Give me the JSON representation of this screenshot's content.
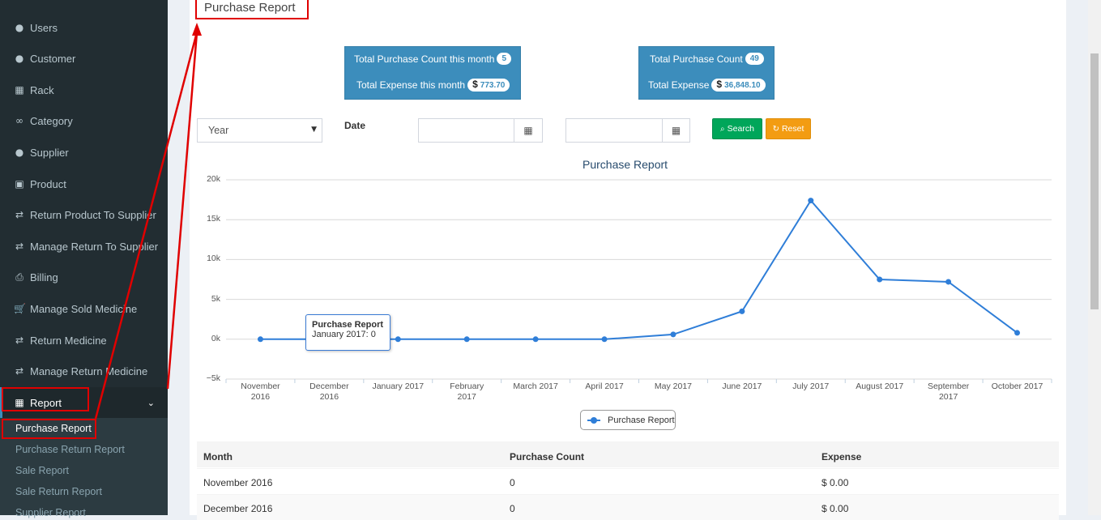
{
  "sidebar": {
    "items": [
      {
        "label": "Users",
        "icon": "user-icon",
        "glyph": "●"
      },
      {
        "label": "Customer",
        "icon": "user-icon",
        "glyph": "●"
      },
      {
        "label": "Rack",
        "icon": "table-icon",
        "glyph": "▦"
      },
      {
        "label": "Category",
        "icon": "link-icon",
        "glyph": "∞"
      },
      {
        "label": "Supplier",
        "icon": "user-icon",
        "glyph": "●"
      },
      {
        "label": "Product",
        "icon": "product-icon",
        "glyph": "▣"
      },
      {
        "label": "Return Product To Supplier",
        "icon": "exchange-icon",
        "glyph": "⇄"
      },
      {
        "label": "Manage Return To Supplier",
        "icon": "exchange-icon",
        "glyph": "⇄"
      },
      {
        "label": "Billing",
        "icon": "print-icon",
        "glyph": "⎙"
      },
      {
        "label": "Manage Sold Medicine",
        "icon": "cart-icon",
        "glyph": "🛒"
      },
      {
        "label": "Return Medicine",
        "icon": "exchange-icon",
        "glyph": "⇄"
      },
      {
        "label": "Manage Return Medicine",
        "icon": "exchange-icon",
        "glyph": "⇄"
      },
      {
        "label": "Report",
        "icon": "table-icon",
        "glyph": "▦"
      }
    ],
    "submenu": [
      "Purchase Report",
      "Purchase Return Report",
      "Sale Report",
      "Sale Return Report",
      "Supplier Report"
    ],
    "chevron": "⌄"
  },
  "page_title": "Purchase Report",
  "stats": {
    "month_count_label": "Total Purchase Count this month",
    "month_count_value": "5",
    "month_expense_label": "Total Expense this month",
    "month_expense_value": "773.70",
    "total_count_label": "Total Purchase Count",
    "total_count_value": "49",
    "total_expense_label": "Total Expense",
    "total_expense_value": "36,848.10",
    "currency": "$"
  },
  "filters": {
    "period_select": "Year",
    "date_label": "Date",
    "search_label": "Search",
    "reset_label": "Reset"
  },
  "chart_data": {
    "type": "line",
    "title": "Purchase Report",
    "categories": [
      "November 2016",
      "December 2016",
      "January 2017",
      "February 2017",
      "March 2017",
      "April 2017",
      "May 2017",
      "June 2017",
      "July 2017",
      "August 2017",
      "September 2017",
      "October 2017"
    ],
    "category_lines": [
      [
        "November",
        "2016"
      ],
      [
        "December",
        "2016"
      ],
      [
        "January 2017"
      ],
      [
        "February",
        "2017"
      ],
      [
        "March 2017"
      ],
      [
        "April 2017"
      ],
      [
        "May 2017"
      ],
      [
        "June 2017"
      ],
      [
        "July 2017"
      ],
      [
        "August 2017"
      ],
      [
        "September",
        "2017"
      ],
      [
        "October 2017"
      ]
    ],
    "series": [
      {
        "name": "Purchase Report",
        "values": [
          0,
          0,
          0,
          0,
          0,
          0,
          600,
          3500,
          17400,
          7500,
          7200,
          800
        ],
        "color": "#2f7ed8"
      }
    ],
    "yticks": [
      "20k",
      "15k",
      "10k",
      "5k",
      "0k",
      "−5k"
    ],
    "ytick_values": [
      20000,
      15000,
      10000,
      5000,
      0,
      -5000
    ],
    "ylim": [
      -5000,
      20000
    ],
    "grid": true,
    "legend": "bottom-center",
    "tooltip": {
      "title": "Purchase Report",
      "text": "January 2017: 0"
    }
  },
  "table": {
    "headers": [
      "Month",
      "Purchase Count",
      "Expense"
    ],
    "rows": [
      [
        "November 2016",
        "0",
        "$ 0.00"
      ],
      [
        "December 2016",
        "0",
        "$ 0.00"
      ]
    ]
  }
}
